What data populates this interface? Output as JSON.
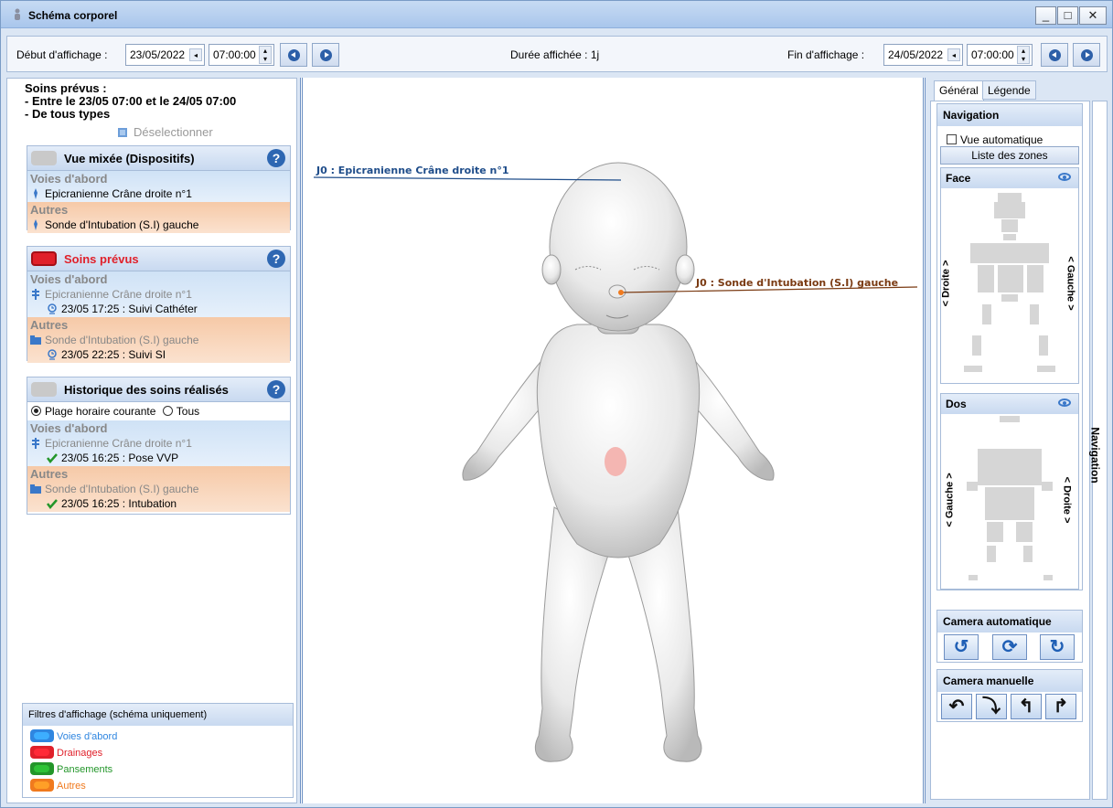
{
  "window": {
    "title": "Schéma corporel",
    "min": "_",
    "max": "□",
    "close": "✕"
  },
  "toolbar": {
    "start_label": "Début d'affichage :",
    "start_date": "23/05/2022",
    "start_time": "07:00:00",
    "duration": "Durée affichée : 1j",
    "end_label": "Fin d'affichage :",
    "end_date": "24/05/2022",
    "end_time": "07:00:00"
  },
  "summary": {
    "line1": "Soins prévus :",
    "line2": "- Entre le 23/05 07:00 et le 24/05 07:00",
    "line3": "- De tous types",
    "deselect": "Déselectionner"
  },
  "cards": {
    "mixed": {
      "title": "Vue mixée (Dispositifs)",
      "sec1_title": "Voies d'abord",
      "sec1_item": "Epicranienne Crâne droite n°1",
      "sec2_title": "Autres",
      "sec2_item": "Sonde d'Intubation (S.I) gauche"
    },
    "planned": {
      "title": "Soins prévus",
      "sec1_title": "Voies d'abord",
      "sec1_item": "Epicranienne Crâne droite n°1",
      "sec1_event": "23/05 17:25 : Suivi Cathéter",
      "sec2_title": "Autres",
      "sec2_item": "Sonde d'Intubation (S.I) gauche",
      "sec2_event": "23/05 22:25 : Suivi SI"
    },
    "history": {
      "title": "Historique des soins réalisés",
      "radio1": "Plage horaire courante",
      "radio2": "Tous",
      "sec1_title": "Voies d'abord",
      "sec1_item": "Epicranienne Crâne droite n°1",
      "sec1_event": "23/05 16:25 : Pose VVP",
      "sec2_title": "Autres",
      "sec2_item": "Sonde d'Intubation (S.I) gauche",
      "sec2_event": "23/05 16:25 : Intubation"
    },
    "help": "?"
  },
  "filters": {
    "title": "Filtres d'affichage (schéma uniquement)",
    "items": [
      {
        "label": "Voies d'abord",
        "color": "#2f86e0"
      },
      {
        "label": "Drainages",
        "color": "#e0202a"
      },
      {
        "label": "Pansements",
        "color": "#23962a"
      },
      {
        "label": "Autres",
        "color": "#f07a1e"
      }
    ]
  },
  "annotations": {
    "head": "J0 : Epicranienne Crâne droite n°1",
    "nose": "J0 : Sonde d'Intubation (S.I) gauche",
    "head_color": "#1f4d8a",
    "nose_color": "#7a3a12"
  },
  "right": {
    "tab_general": "Général",
    "tab_legend": "Légende",
    "side_tab": "Navigation",
    "nav_title": "Navigation",
    "auto_view": "Vue automatique",
    "zones_button": "Liste des zones",
    "face_title": "Face",
    "face_right": "< Droite >",
    "face_left": "< Gauche >",
    "back_title": "Dos",
    "back_left": "< Gauche >",
    "back_right": "< Droite >",
    "cam_auto_title": "Camera automatique",
    "cam_manual_title": "Camera manuelle"
  }
}
